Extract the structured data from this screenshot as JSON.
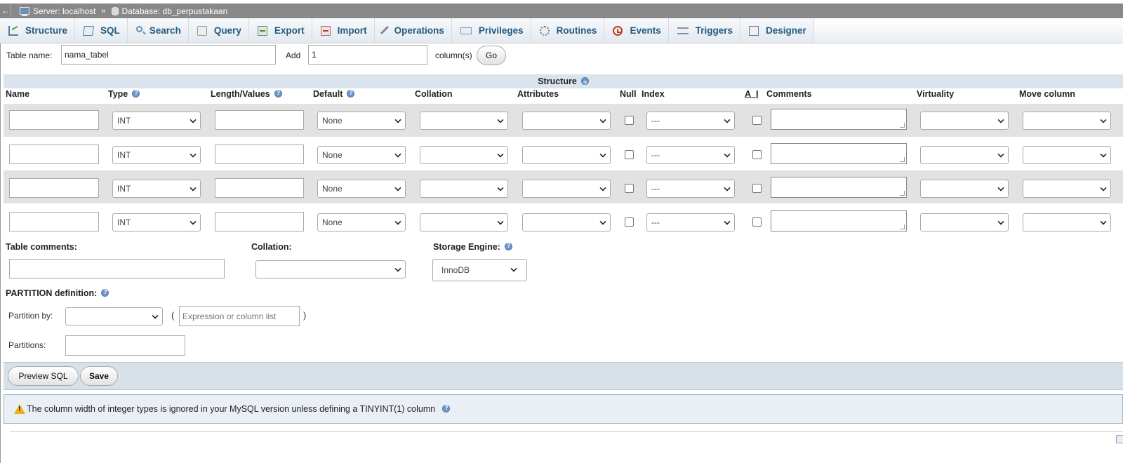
{
  "breadcrumb": {
    "back": "←",
    "server": "Server: localhost",
    "separator": "»",
    "database": "Database: db_perpustakaan"
  },
  "tabs": [
    {
      "label": "Structure",
      "icon": "structure-icon"
    },
    {
      "label": "SQL",
      "icon": "sql-icon"
    },
    {
      "label": "Search",
      "icon": "search-icon"
    },
    {
      "label": "Query",
      "icon": "query-icon"
    },
    {
      "label": "Export",
      "icon": "export-icon"
    },
    {
      "label": "Import",
      "icon": "import-icon"
    },
    {
      "label": "Operations",
      "icon": "wrench-icon"
    },
    {
      "label": "Privileges",
      "icon": "privileges-icon"
    },
    {
      "label": "Routines",
      "icon": "routines-icon"
    },
    {
      "label": "Events",
      "icon": "clock-icon"
    },
    {
      "label": "Triggers",
      "icon": "triggers-icon"
    },
    {
      "label": "Designer",
      "icon": "designer-icon"
    }
  ],
  "table_form": {
    "table_name_label": "Table name:",
    "table_name_value": "nama_tabel",
    "add_label": "Add",
    "add_value": "1",
    "columns_label": "column(s)",
    "go_label": "Go"
  },
  "structure": {
    "title": "Structure",
    "headers": {
      "name": "Name",
      "type": "Type",
      "length": "Length/Values",
      "default": "Default",
      "collation": "Collation",
      "attributes": "Attributes",
      "null": "Null",
      "index": "Index",
      "ai": "A_I",
      "comments": "Comments",
      "virtuality": "Virtuality",
      "move": "Move column"
    },
    "rows": [
      {
        "type": "INT",
        "default": "None",
        "index": "---"
      },
      {
        "type": "INT",
        "default": "None",
        "index": "---"
      },
      {
        "type": "INT",
        "default": "None",
        "index": "---"
      },
      {
        "type": "INT",
        "default": "None",
        "index": "---"
      }
    ]
  },
  "table_options": {
    "comments_label": "Table comments:",
    "collation_label": "Collation:",
    "engine_label": "Storage Engine:",
    "engine_value": "InnoDB"
  },
  "partition": {
    "title": "PARTITION definition:",
    "by_label": "Partition by:",
    "paren_open": "(",
    "paren_close": ")",
    "expression_placeholder": "Expression or column list",
    "partitions_label": "Partitions:"
  },
  "footer": {
    "preview_label": "Preview SQL",
    "save_label": "Save"
  },
  "notice": {
    "text": "The column width of integer types is ignored in your MySQL version unless defining a TINYINT(1) column"
  }
}
